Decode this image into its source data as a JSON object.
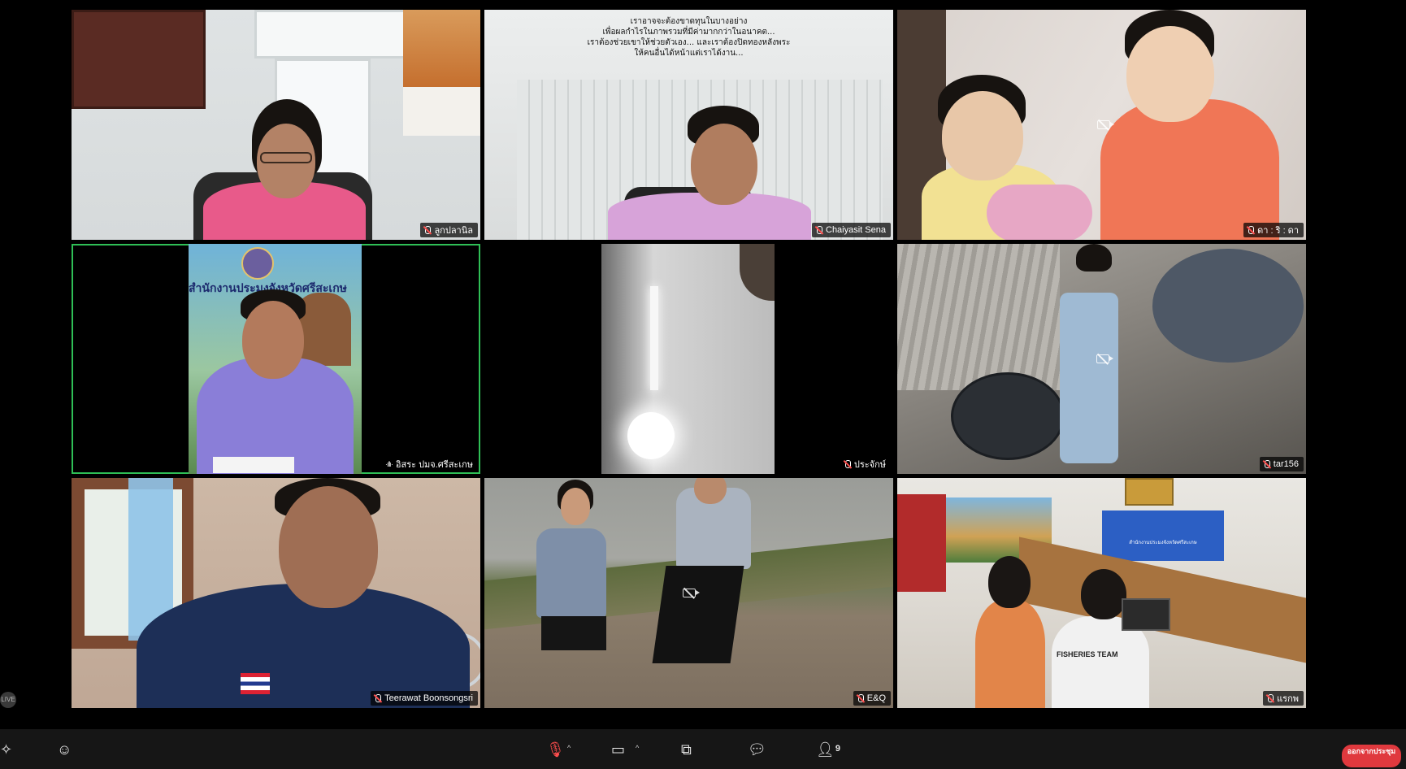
{
  "participants": [
    {
      "name": "ลูกปลานิล"
    },
    {
      "name": "Chaiyasit Sena"
    },
    {
      "name": "ดา : ริ : ดา"
    },
    {
      "name": "อิสระ ปมจ.ศรีสะเกษ",
      "speaking": true
    },
    {
      "name": "ประจักษ์"
    },
    {
      "name": "tar156"
    },
    {
      "name": "Teerawat Boonsongsri"
    },
    {
      "name": "E&Q"
    },
    {
      "name": "แรกพ"
    }
  ],
  "tile_texts": {
    "wall_quote": [
      "เราอาจจะต้องขาดทุนในบางอย่าง",
      "เพื่อผลกำไรในภาพรวมที่มีค่ามากกว่าในอนาคต...",
      "เราต้องช่วยเขาให้ช่วยตัวเอง... และเราต้องปิดทองหลังพระ",
      "ให้คนอื่นได้หน้าแต่เราได้งาน..."
    ],
    "background_banner": "สำนักงานประมงจังหวัดศรีสะเกษ",
    "meeting_room_sign": "สำนักงานประมงจังหวัดศรีสะเกษ",
    "meeting_room_shirt": "FISHERIES TEAM"
  },
  "toolbar": {
    "participant_count": "9",
    "leave_label": "ออกจากประชุม",
    "live_badge": "LIVE"
  },
  "colors": {
    "active_speaker_border": "#2fbf56",
    "leave_button": "#e0393e"
  }
}
